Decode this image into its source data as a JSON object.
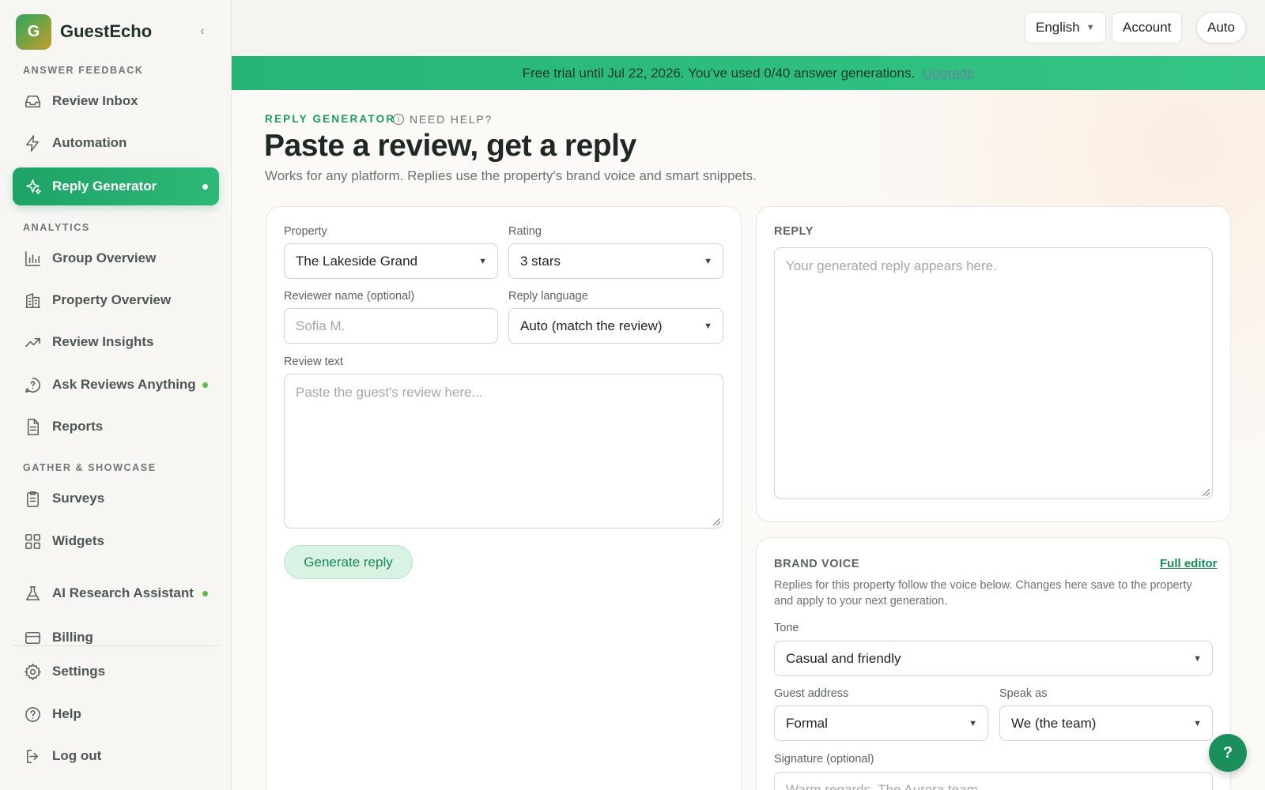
{
  "brand": {
    "logo_letter": "G",
    "name": "GuestEcho"
  },
  "sidebar": {
    "collapse_icon": "chevron-left-icon",
    "sections": {
      "answer": "ANSWER FEEDBACK",
      "analytics": "ANALYTICS",
      "gather": "GATHER & SHOWCASE"
    },
    "items": {
      "review_inbox": "Review Inbox",
      "automation": "Automation",
      "reply_generator": "Reply Generator",
      "group_overview": "Group Overview",
      "property_overview": "Property Overview",
      "review_insights": "Review Insights",
      "ask_reviews": "Ask Reviews Anything",
      "reports": "Reports",
      "surveys": "Surveys",
      "widgets": "Widgets",
      "ai_research": "AI Research Assistant",
      "billing": "Billing",
      "settings": "Settings",
      "help": "Help",
      "logout": "Log out"
    },
    "active_item": "Reply Generator"
  },
  "topbar": {
    "language": "English",
    "account": "Account",
    "theme": "Auto"
  },
  "banner": {
    "text": "Free trial until Jul 22, 2026. You've used 0/40 answer generations.",
    "link": "Upgrade"
  },
  "header": {
    "eyebrow": "REPLY GENERATOR",
    "need_help": "NEED HELP?",
    "title": "Paste a review, get a reply",
    "subtitle": "Works for any platform. Replies use the property's brand voice and smart snippets."
  },
  "form": {
    "property_label": "Property",
    "property_value": "The Lakeside Grand",
    "rating_label": "Rating",
    "rating_value": "3 stars",
    "reviewer_label": "Reviewer name (optional)",
    "reviewer_placeholder": "Sofia M.",
    "language_label": "Reply language",
    "language_value": "Auto (match the review)",
    "review_label": "Review text",
    "review_placeholder": "Paste the guest's review here...",
    "generate_label": "Generate reply"
  },
  "reply": {
    "title": "REPLY",
    "placeholder": "Your generated reply appears here."
  },
  "brand_voice": {
    "title": "BRAND VOICE",
    "full_editor": "Full editor",
    "description": "Replies for this property follow the voice below. Changes here save to the property and apply to your next generation.",
    "tone_label": "Tone",
    "tone_value": "Casual and friendly",
    "address_label": "Guest address",
    "address_value": "Formal",
    "speak_label": "Speak as",
    "speak_value": "We (the team)",
    "signature_label": "Signature (optional)",
    "signature_placeholder": "Warm regards, The Aurora team"
  },
  "help_fab": "?",
  "colors": {
    "accent": "#1ea266",
    "banner": "#2dbd7e",
    "status_dot": "#5fbe4c"
  }
}
